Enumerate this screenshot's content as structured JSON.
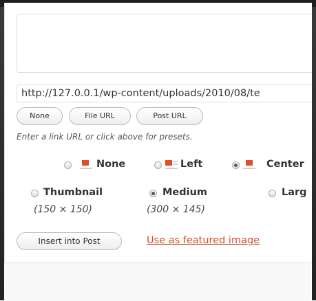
{
  "link": {
    "url_value": "http://127.0.0.1/wp-content/uploads/2010/08/te",
    "buttons": [
      "None",
      "File URL",
      "Post URL"
    ],
    "help": "Enter a link URL or click above for presets."
  },
  "alignment": {
    "options": [
      {
        "label": "None",
        "selected": false
      },
      {
        "label": "Left",
        "selected": false
      },
      {
        "label": "Center",
        "selected": true
      }
    ]
  },
  "size": {
    "options": [
      {
        "label": "Thumbnail",
        "dims": "(150 × 150)",
        "selected": false
      },
      {
        "label": "Medium",
        "dims": "(300 × 145)",
        "selected": true
      },
      {
        "label": "Larg",
        "dims": "",
        "selected": false
      }
    ]
  },
  "actions": {
    "insert_label": "Insert into Post",
    "featured_label": "Use as featured image"
  },
  "colors": {
    "accent": "#d54e21",
    "icon_block": "#e14d2a"
  }
}
